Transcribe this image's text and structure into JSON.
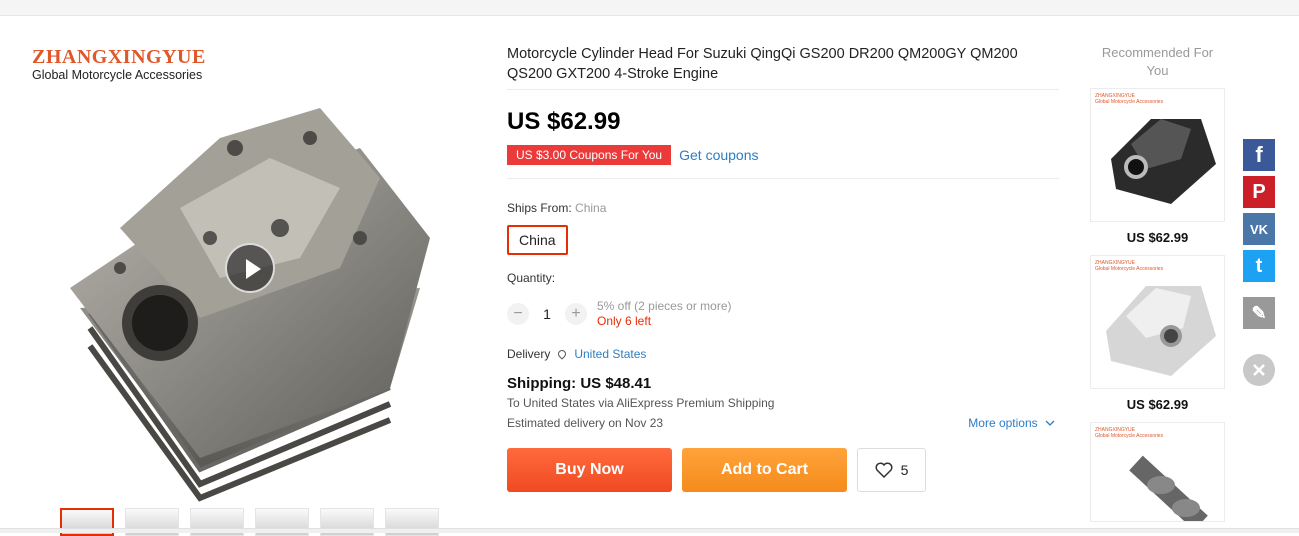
{
  "brand": {
    "name": "ZHANGXINGYUE",
    "subtitle": "Global Motorcycle Accessories"
  },
  "product": {
    "title": "Motorcycle Cylinder Head For Suzuki QingQi GS200 DR200 QM200GY QM200 QS200 GXT200 4-Stroke Engine",
    "price": "US $62.99",
    "coupon_badge": "US $3.00 Coupons For You",
    "get_coupons": "Get coupons",
    "ships_from_label": "Ships From:",
    "ships_from_value": "China",
    "ships_from_option": "China",
    "quantity_label": "Quantity:",
    "quantity_minus": "−",
    "quantity_value": "1",
    "quantity_plus": "+",
    "discount_note": "5% off (2 pieces or more)",
    "stock_note": "Only 6 left",
    "delivery_label": "Delivery",
    "delivery_country": "United States",
    "shipping": "Shipping: US $48.41",
    "shipping_via": "To United States via AliExpress Premium Shipping",
    "estimated_delivery": "Estimated delivery on Nov 23",
    "more_options": "More options",
    "buy_now": "Buy Now",
    "add_to_cart": "Add to Cart",
    "wishlist_count": "5"
  },
  "recommended": {
    "title": "Recommended For You",
    "items": [
      {
        "price": "US $62.99",
        "tone": "dark"
      },
      {
        "price": "US $62.99",
        "tone": "silver"
      },
      {
        "price": "",
        "tone": "camshaft"
      }
    ]
  },
  "social": [
    {
      "name": "facebook-icon",
      "glyph": "f",
      "color": "#3b5998"
    },
    {
      "name": "pinterest-icon",
      "glyph": "P",
      "color": "#cb2027"
    },
    {
      "name": "vk-icon",
      "glyph": "VK",
      "color": "#4a76a8"
    },
    {
      "name": "twitter-icon",
      "glyph": "t",
      "color": "#1da1f2"
    },
    {
      "name": "edit-icon",
      "glyph": "✎",
      "color": "#999999"
    }
  ],
  "thumbnails": 6,
  "colors": {
    "accent": "#e62e04",
    "link": "#2e7dc4",
    "buy": "#f04a22",
    "cart": "#f58b1c"
  }
}
